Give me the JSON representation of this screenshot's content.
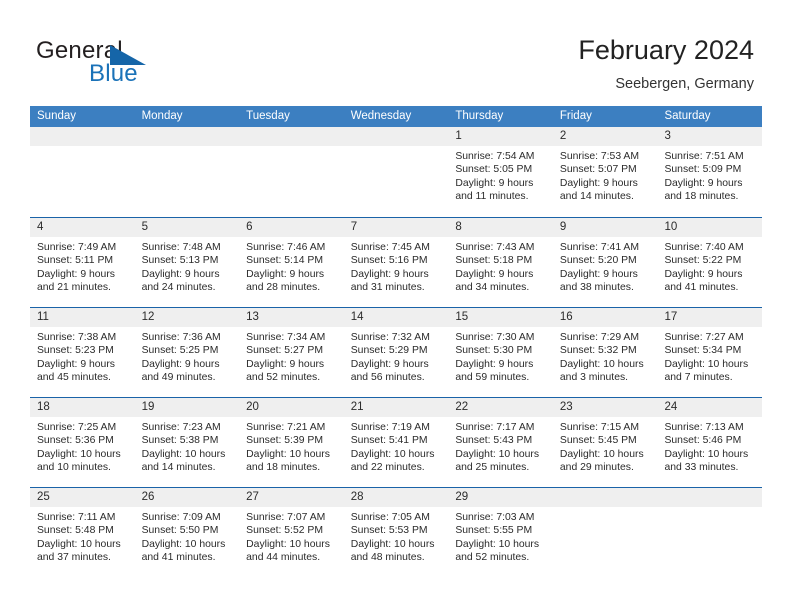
{
  "brand": {
    "word1": "General",
    "word2": "Blue",
    "triangle_color": "#1565a8",
    "blue_color": "#1a72b8"
  },
  "header": {
    "title": "February 2024",
    "subtitle": "Seebergen, Germany"
  },
  "theme": {
    "header_row_bg": "#3c7fc1",
    "row_separator": "#1a63a8",
    "day_band_bg": "#efefef"
  },
  "weekdays": [
    "Sunday",
    "Monday",
    "Tuesday",
    "Wednesday",
    "Thursday",
    "Friday",
    "Saturday"
  ],
  "weeks": [
    [
      {
        "day": "",
        "lines": []
      },
      {
        "day": "",
        "lines": []
      },
      {
        "day": "",
        "lines": []
      },
      {
        "day": "",
        "lines": []
      },
      {
        "day": "1",
        "lines": [
          "Sunrise: 7:54 AM",
          "Sunset: 5:05 PM",
          "Daylight: 9 hours",
          "and 11 minutes."
        ]
      },
      {
        "day": "2",
        "lines": [
          "Sunrise: 7:53 AM",
          "Sunset: 5:07 PM",
          "Daylight: 9 hours",
          "and 14 minutes."
        ]
      },
      {
        "day": "3",
        "lines": [
          "Sunrise: 7:51 AM",
          "Sunset: 5:09 PM",
          "Daylight: 9 hours",
          "and 18 minutes."
        ]
      }
    ],
    [
      {
        "day": "4",
        "lines": [
          "Sunrise: 7:49 AM",
          "Sunset: 5:11 PM",
          "Daylight: 9 hours",
          "and 21 minutes."
        ]
      },
      {
        "day": "5",
        "lines": [
          "Sunrise: 7:48 AM",
          "Sunset: 5:13 PM",
          "Daylight: 9 hours",
          "and 24 minutes."
        ]
      },
      {
        "day": "6",
        "lines": [
          "Sunrise: 7:46 AM",
          "Sunset: 5:14 PM",
          "Daylight: 9 hours",
          "and 28 minutes."
        ]
      },
      {
        "day": "7",
        "lines": [
          "Sunrise: 7:45 AM",
          "Sunset: 5:16 PM",
          "Daylight: 9 hours",
          "and 31 minutes."
        ]
      },
      {
        "day": "8",
        "lines": [
          "Sunrise: 7:43 AM",
          "Sunset: 5:18 PM",
          "Daylight: 9 hours",
          "and 34 minutes."
        ]
      },
      {
        "day": "9",
        "lines": [
          "Sunrise: 7:41 AM",
          "Sunset: 5:20 PM",
          "Daylight: 9 hours",
          "and 38 minutes."
        ]
      },
      {
        "day": "10",
        "lines": [
          "Sunrise: 7:40 AM",
          "Sunset: 5:22 PM",
          "Daylight: 9 hours",
          "and 41 minutes."
        ]
      }
    ],
    [
      {
        "day": "11",
        "lines": [
          "Sunrise: 7:38 AM",
          "Sunset: 5:23 PM",
          "Daylight: 9 hours",
          "and 45 minutes."
        ]
      },
      {
        "day": "12",
        "lines": [
          "Sunrise: 7:36 AM",
          "Sunset: 5:25 PM",
          "Daylight: 9 hours",
          "and 49 minutes."
        ]
      },
      {
        "day": "13",
        "lines": [
          "Sunrise: 7:34 AM",
          "Sunset: 5:27 PM",
          "Daylight: 9 hours",
          "and 52 minutes."
        ]
      },
      {
        "day": "14",
        "lines": [
          "Sunrise: 7:32 AM",
          "Sunset: 5:29 PM",
          "Daylight: 9 hours",
          "and 56 minutes."
        ]
      },
      {
        "day": "15",
        "lines": [
          "Sunrise: 7:30 AM",
          "Sunset: 5:30 PM",
          "Daylight: 9 hours",
          "and 59 minutes."
        ]
      },
      {
        "day": "16",
        "lines": [
          "Sunrise: 7:29 AM",
          "Sunset: 5:32 PM",
          "Daylight: 10 hours",
          "and 3 minutes."
        ]
      },
      {
        "day": "17",
        "lines": [
          "Sunrise: 7:27 AM",
          "Sunset: 5:34 PM",
          "Daylight: 10 hours",
          "and 7 minutes."
        ]
      }
    ],
    [
      {
        "day": "18",
        "lines": [
          "Sunrise: 7:25 AM",
          "Sunset: 5:36 PM",
          "Daylight: 10 hours",
          "and 10 minutes."
        ]
      },
      {
        "day": "19",
        "lines": [
          "Sunrise: 7:23 AM",
          "Sunset: 5:38 PM",
          "Daylight: 10 hours",
          "and 14 minutes."
        ]
      },
      {
        "day": "20",
        "lines": [
          "Sunrise: 7:21 AM",
          "Sunset: 5:39 PM",
          "Daylight: 10 hours",
          "and 18 minutes."
        ]
      },
      {
        "day": "21",
        "lines": [
          "Sunrise: 7:19 AM",
          "Sunset: 5:41 PM",
          "Daylight: 10 hours",
          "and 22 minutes."
        ]
      },
      {
        "day": "22",
        "lines": [
          "Sunrise: 7:17 AM",
          "Sunset: 5:43 PM",
          "Daylight: 10 hours",
          "and 25 minutes."
        ]
      },
      {
        "day": "23",
        "lines": [
          "Sunrise: 7:15 AM",
          "Sunset: 5:45 PM",
          "Daylight: 10 hours",
          "and 29 minutes."
        ]
      },
      {
        "day": "24",
        "lines": [
          "Sunrise: 7:13 AM",
          "Sunset: 5:46 PM",
          "Daylight: 10 hours",
          "and 33 minutes."
        ]
      }
    ],
    [
      {
        "day": "25",
        "lines": [
          "Sunrise: 7:11 AM",
          "Sunset: 5:48 PM",
          "Daylight: 10 hours",
          "and 37 minutes."
        ]
      },
      {
        "day": "26",
        "lines": [
          "Sunrise: 7:09 AM",
          "Sunset: 5:50 PM",
          "Daylight: 10 hours",
          "and 41 minutes."
        ]
      },
      {
        "day": "27",
        "lines": [
          "Sunrise: 7:07 AM",
          "Sunset: 5:52 PM",
          "Daylight: 10 hours",
          "and 44 minutes."
        ]
      },
      {
        "day": "28",
        "lines": [
          "Sunrise: 7:05 AM",
          "Sunset: 5:53 PM",
          "Daylight: 10 hours",
          "and 48 minutes."
        ]
      },
      {
        "day": "29",
        "lines": [
          "Sunrise: 7:03 AM",
          "Sunset: 5:55 PM",
          "Daylight: 10 hours",
          "and 52 minutes."
        ]
      },
      {
        "day": "",
        "lines": []
      },
      {
        "day": "",
        "lines": []
      }
    ]
  ]
}
